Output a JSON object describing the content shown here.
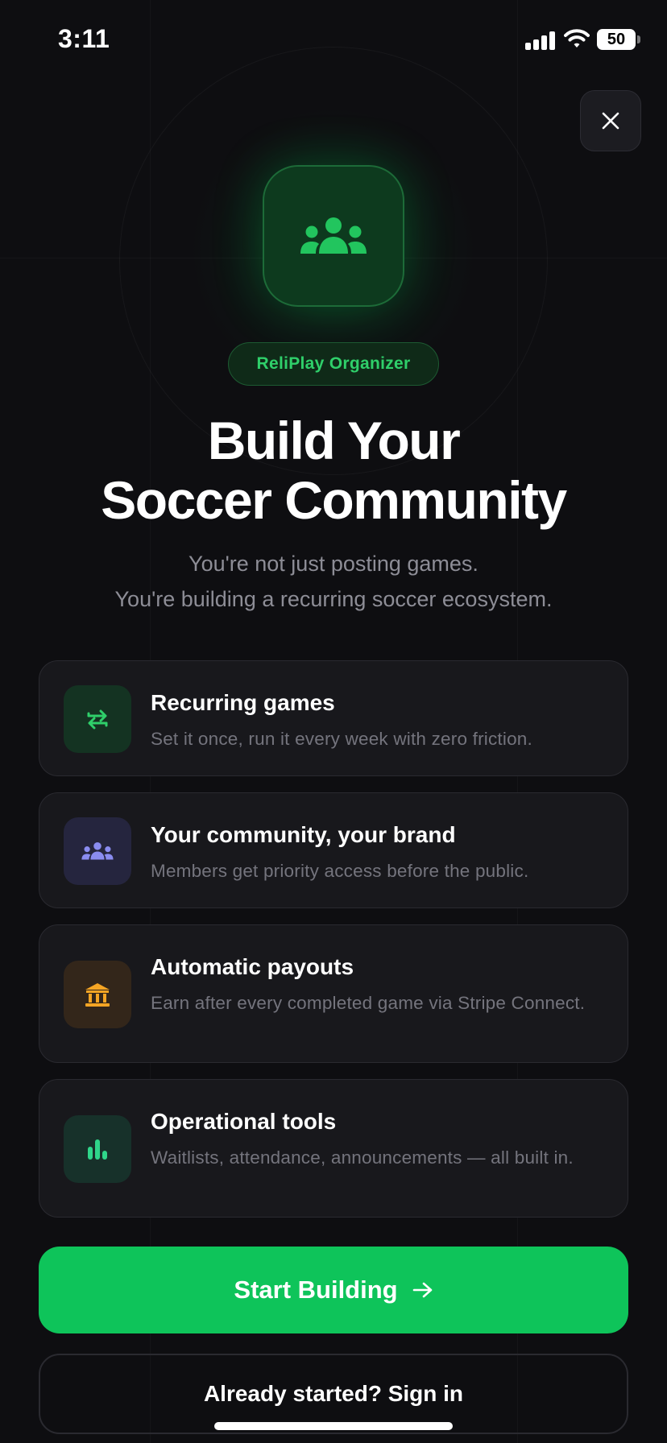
{
  "status_bar": {
    "time": "3:11",
    "battery": "50"
  },
  "header": {
    "close_icon": "close-icon"
  },
  "hero": {
    "icon": "community-icon",
    "badge": "ReliPlay Organizer",
    "title_line1": "Build Your",
    "title_line2": "Soccer Community",
    "subtitle_line1": "You're not just posting games.",
    "subtitle_line2": "You're building a recurring soccer ecosystem."
  },
  "features": [
    {
      "icon": "repeat-icon",
      "color": "#2fcf6a",
      "bg": "#143322",
      "title": "Recurring games",
      "desc": "Set it once, run it every week with zero friction."
    },
    {
      "icon": "users-icon",
      "color": "#8a8cf0",
      "bg": "#25253e",
      "title": "Your community, your brand",
      "desc": "Members get priority access before the public."
    },
    {
      "icon": "bank-icon",
      "color": "#f5a524",
      "bg": "#33261a",
      "title": "Automatic payouts",
      "desc": "Earn after every completed game via Stripe Connect."
    },
    {
      "icon": "bar-chart-icon",
      "color": "#2fd68a",
      "bg": "#17312a",
      "title": "Operational tools",
      "desc": "Waitlists, attendance, announcements — all built in."
    }
  ],
  "actions": {
    "primary_label": "Start Building",
    "secondary_label": "Already started? Sign in"
  },
  "colors": {
    "accent": "#0ec45a",
    "background": "#0e0e11"
  }
}
